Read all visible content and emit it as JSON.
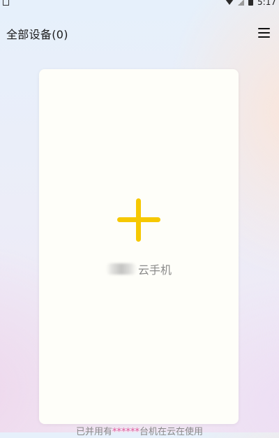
{
  "status_bar": {
    "time": "5:17",
    "icons": [
      "notification-a-icon",
      "wifi-icon",
      "no-signal-icon",
      "battery-icon"
    ]
  },
  "header": {
    "title": "全部设备(0)",
    "menu_icon": "hamburger-menu-icon"
  },
  "add_card": {
    "icon": "plus-icon",
    "icon_color": "#f6c800",
    "caption": "云手机"
  },
  "bottom_note": {
    "prefix": "已并用有",
    "highlight": "******",
    "suffix": "台机在云在使用"
  }
}
